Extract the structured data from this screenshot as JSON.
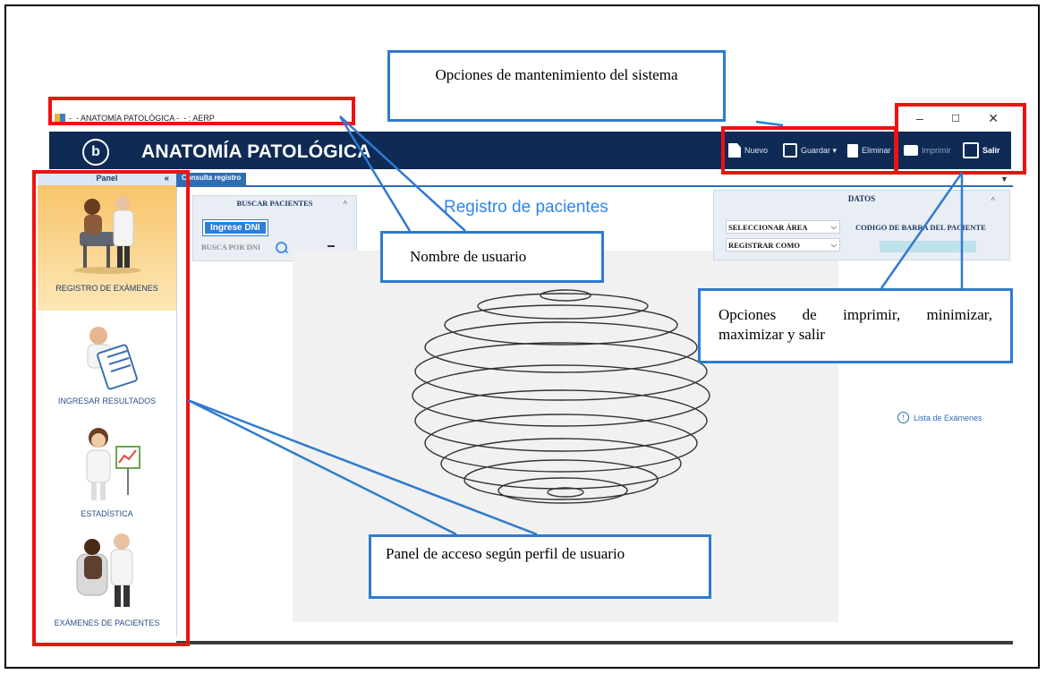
{
  "window": {
    "title": "-_- ANATOMÍA PATOLÓGICA -_- : AERP",
    "controls": {
      "minimize": "–",
      "maximize": "☐",
      "close": "✕"
    }
  },
  "header": {
    "logo": "b",
    "app_title": "ANATOMÍA PATOLÓGICA",
    "toolbar": {
      "nuevo": "Nuevo",
      "guardar": "Guardar ▾",
      "eliminar": "Eliminar",
      "imprimir": "Imprimir",
      "salir": "Salir"
    },
    "colors": {
      "bar": "#0e2a55"
    }
  },
  "panel": {
    "title": "Panel",
    "collapse": "«",
    "items": [
      {
        "label": "REGISTRO DE EXÁMENES",
        "icon": "doctor-patient-icon"
      },
      {
        "label": "INGRESAR RESULTADOS",
        "icon": "clipboard-doctor-icon"
      },
      {
        "label": "ESTADÍSTICA",
        "icon": "chart-doctor-icon"
      },
      {
        "label": "EXÁMENES DE PACIENTES",
        "icon": "exam-doctor-icon"
      }
    ]
  },
  "tabs": [
    {
      "label": "Consulta registro"
    }
  ],
  "buscar": {
    "title": "BUSCAR PACIENTES",
    "collapse": "˄",
    "ingrese_label": "Ingrese DNI",
    "busca_label": "BUSCA POR DNI"
  },
  "main": {
    "title": "Registro de pacientes"
  },
  "datos": {
    "title": "DATOS",
    "collapse": "˄",
    "seleccionar": "SELECCIONAR ÁREA",
    "registrar": "REGISTRAR COMO",
    "codigo": "CODIGO DE BARRA DEL PACIENTE"
  },
  "lista": {
    "label": "Lista de Exámenes",
    "icon": "!"
  },
  "callouts": {
    "mantenimiento": "Opciones de mantenimiento del sistema",
    "usuario": "Nombre de usuario",
    "opciones": "Opciones de imprimir, minimizar, maximizar y salir",
    "panel": "Panel de acceso según perfil de usuario"
  }
}
